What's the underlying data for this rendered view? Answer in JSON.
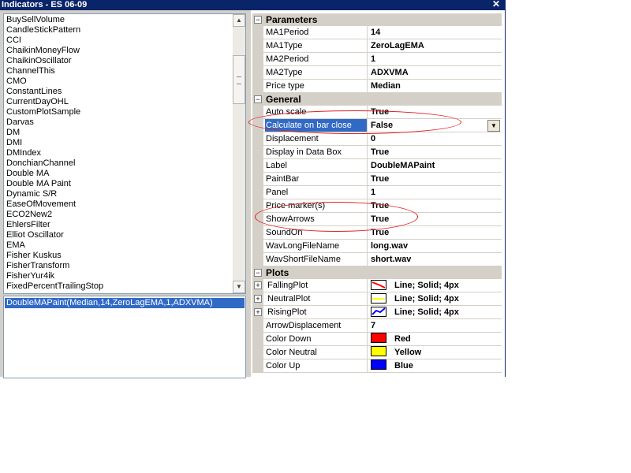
{
  "window": {
    "title": "Indicators - ES 06-09",
    "close_glyph": "✕"
  },
  "indicator_list": [
    "BuySellVolume",
    "CandleStickPattern",
    "CCI",
    "ChaikinMoneyFlow",
    "ChaikinOscillator",
    "ChannelThis",
    "CMO",
    "ConstantLines",
    "CurrentDayOHL",
    "CustomPlotSample",
    "Darvas",
    "DM",
    "DMI",
    "DMIndex",
    "DonchianChannel",
    "Double MA",
    "Double MA Paint",
    "Dynamic S/R",
    "EaseOfMovement",
    "ECO2New2",
    "EhlersFilter",
    "Elliot Oscillator",
    "EMA",
    "Fisher Kuskus",
    "FisherTransform",
    "FisherYur4ik",
    "FixedPercentTrailingStop"
  ],
  "selected_indicators": [
    "DoubleMAPaint(Median,14,ZeroLagEMA,1,ADXVMA)"
  ],
  "properties": {
    "parameters": {
      "header": "Parameters",
      "rows": [
        {
          "name": "MA1Period",
          "value": "14"
        },
        {
          "name": "MA1Type",
          "value": "ZeroLagEMA"
        },
        {
          "name": "MA2Period",
          "value": "1"
        },
        {
          "name": "MA2Type",
          "value": "ADXVMA"
        },
        {
          "name": "Price type",
          "value": "Median"
        }
      ]
    },
    "general": {
      "header": "General",
      "rows": [
        {
          "name": "Auto scale",
          "value": "True"
        },
        {
          "name": "Calculate on bar close",
          "value": "False"
        },
        {
          "name": "Displacement",
          "value": "0"
        },
        {
          "name": "Display in Data Box",
          "value": "True"
        },
        {
          "name": "Label",
          "value": "DoubleMAPaint"
        },
        {
          "name": "PaintBar",
          "value": "True"
        },
        {
          "name": "Panel",
          "value": "1"
        },
        {
          "name": "Price marker(s)",
          "value": "True"
        },
        {
          "name": "ShowArrows",
          "value": "True"
        },
        {
          "name": "SoundOn",
          "value": "True"
        },
        {
          "name": "WavLongFileName",
          "value": "long.wav"
        },
        {
          "name": "WavShortFileName",
          "value": "short.wav"
        }
      ]
    },
    "plots": {
      "header": "Plots",
      "rows": [
        {
          "name": "FallingPlot",
          "value": "Line; Solid; 4px",
          "color": "#ff0000"
        },
        {
          "name": "NeutralPlot",
          "value": "Line; Solid; 4px",
          "color": "#ffff00"
        },
        {
          "name": "RisingPlot",
          "value": "Line; Solid; 4px",
          "color": "#0000ff"
        },
        {
          "name": "ArrowDisplacement",
          "value": "7"
        },
        {
          "name": "Color Down",
          "value": "Red",
          "color": "#ff0000"
        },
        {
          "name": "Color Neutral",
          "value": "Yellow",
          "color": "#ffff00"
        },
        {
          "name": "Color Up",
          "value": "Blue",
          "color": "#0000ff"
        }
      ]
    }
  },
  "icons": {
    "expand": "⊟",
    "collapse": "⊞",
    "scroll_up": "▲",
    "scroll_down": "▼",
    "dropdown": "▼"
  },
  "colors": {
    "title_bar": "#0a246a",
    "selection": "#316ac5",
    "annotation_oval": "#e02020"
  }
}
